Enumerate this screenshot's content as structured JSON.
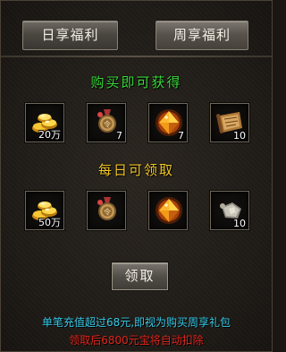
{
  "tabs": {
    "daily_label": "日享福利",
    "weekly_label": "周享福利"
  },
  "sections": {
    "buy_title": "购买即可获得",
    "daily_title": "每日可领取"
  },
  "buy_rewards": [
    {
      "icon": "gold-ingots-icon",
      "qty": "20万"
    },
    {
      "icon": "medal-token-icon",
      "qty": "7"
    },
    {
      "icon": "fire-gem-icon",
      "qty": "7"
    },
    {
      "icon": "scroll-icon",
      "qty": "10"
    }
  ],
  "daily_rewards": [
    {
      "icon": "gold-ingots-icon",
      "qty": "50万"
    },
    {
      "icon": "medal-token-icon",
      "qty": ""
    },
    {
      "icon": "fire-gem-icon",
      "qty": ""
    },
    {
      "icon": "bone-fragment-icon",
      "qty": "10"
    }
  ],
  "claim_label": "领取",
  "notes": {
    "line1": "单笔充值超过68元,即视为购买周享礼包",
    "line2": "领取后6800元宝将自动扣除"
  },
  "colors": {
    "buy_title": "#3ad93a",
    "daily_title": "#f5c827",
    "note1": "#36c9e8",
    "note2": "#e0251c"
  }
}
